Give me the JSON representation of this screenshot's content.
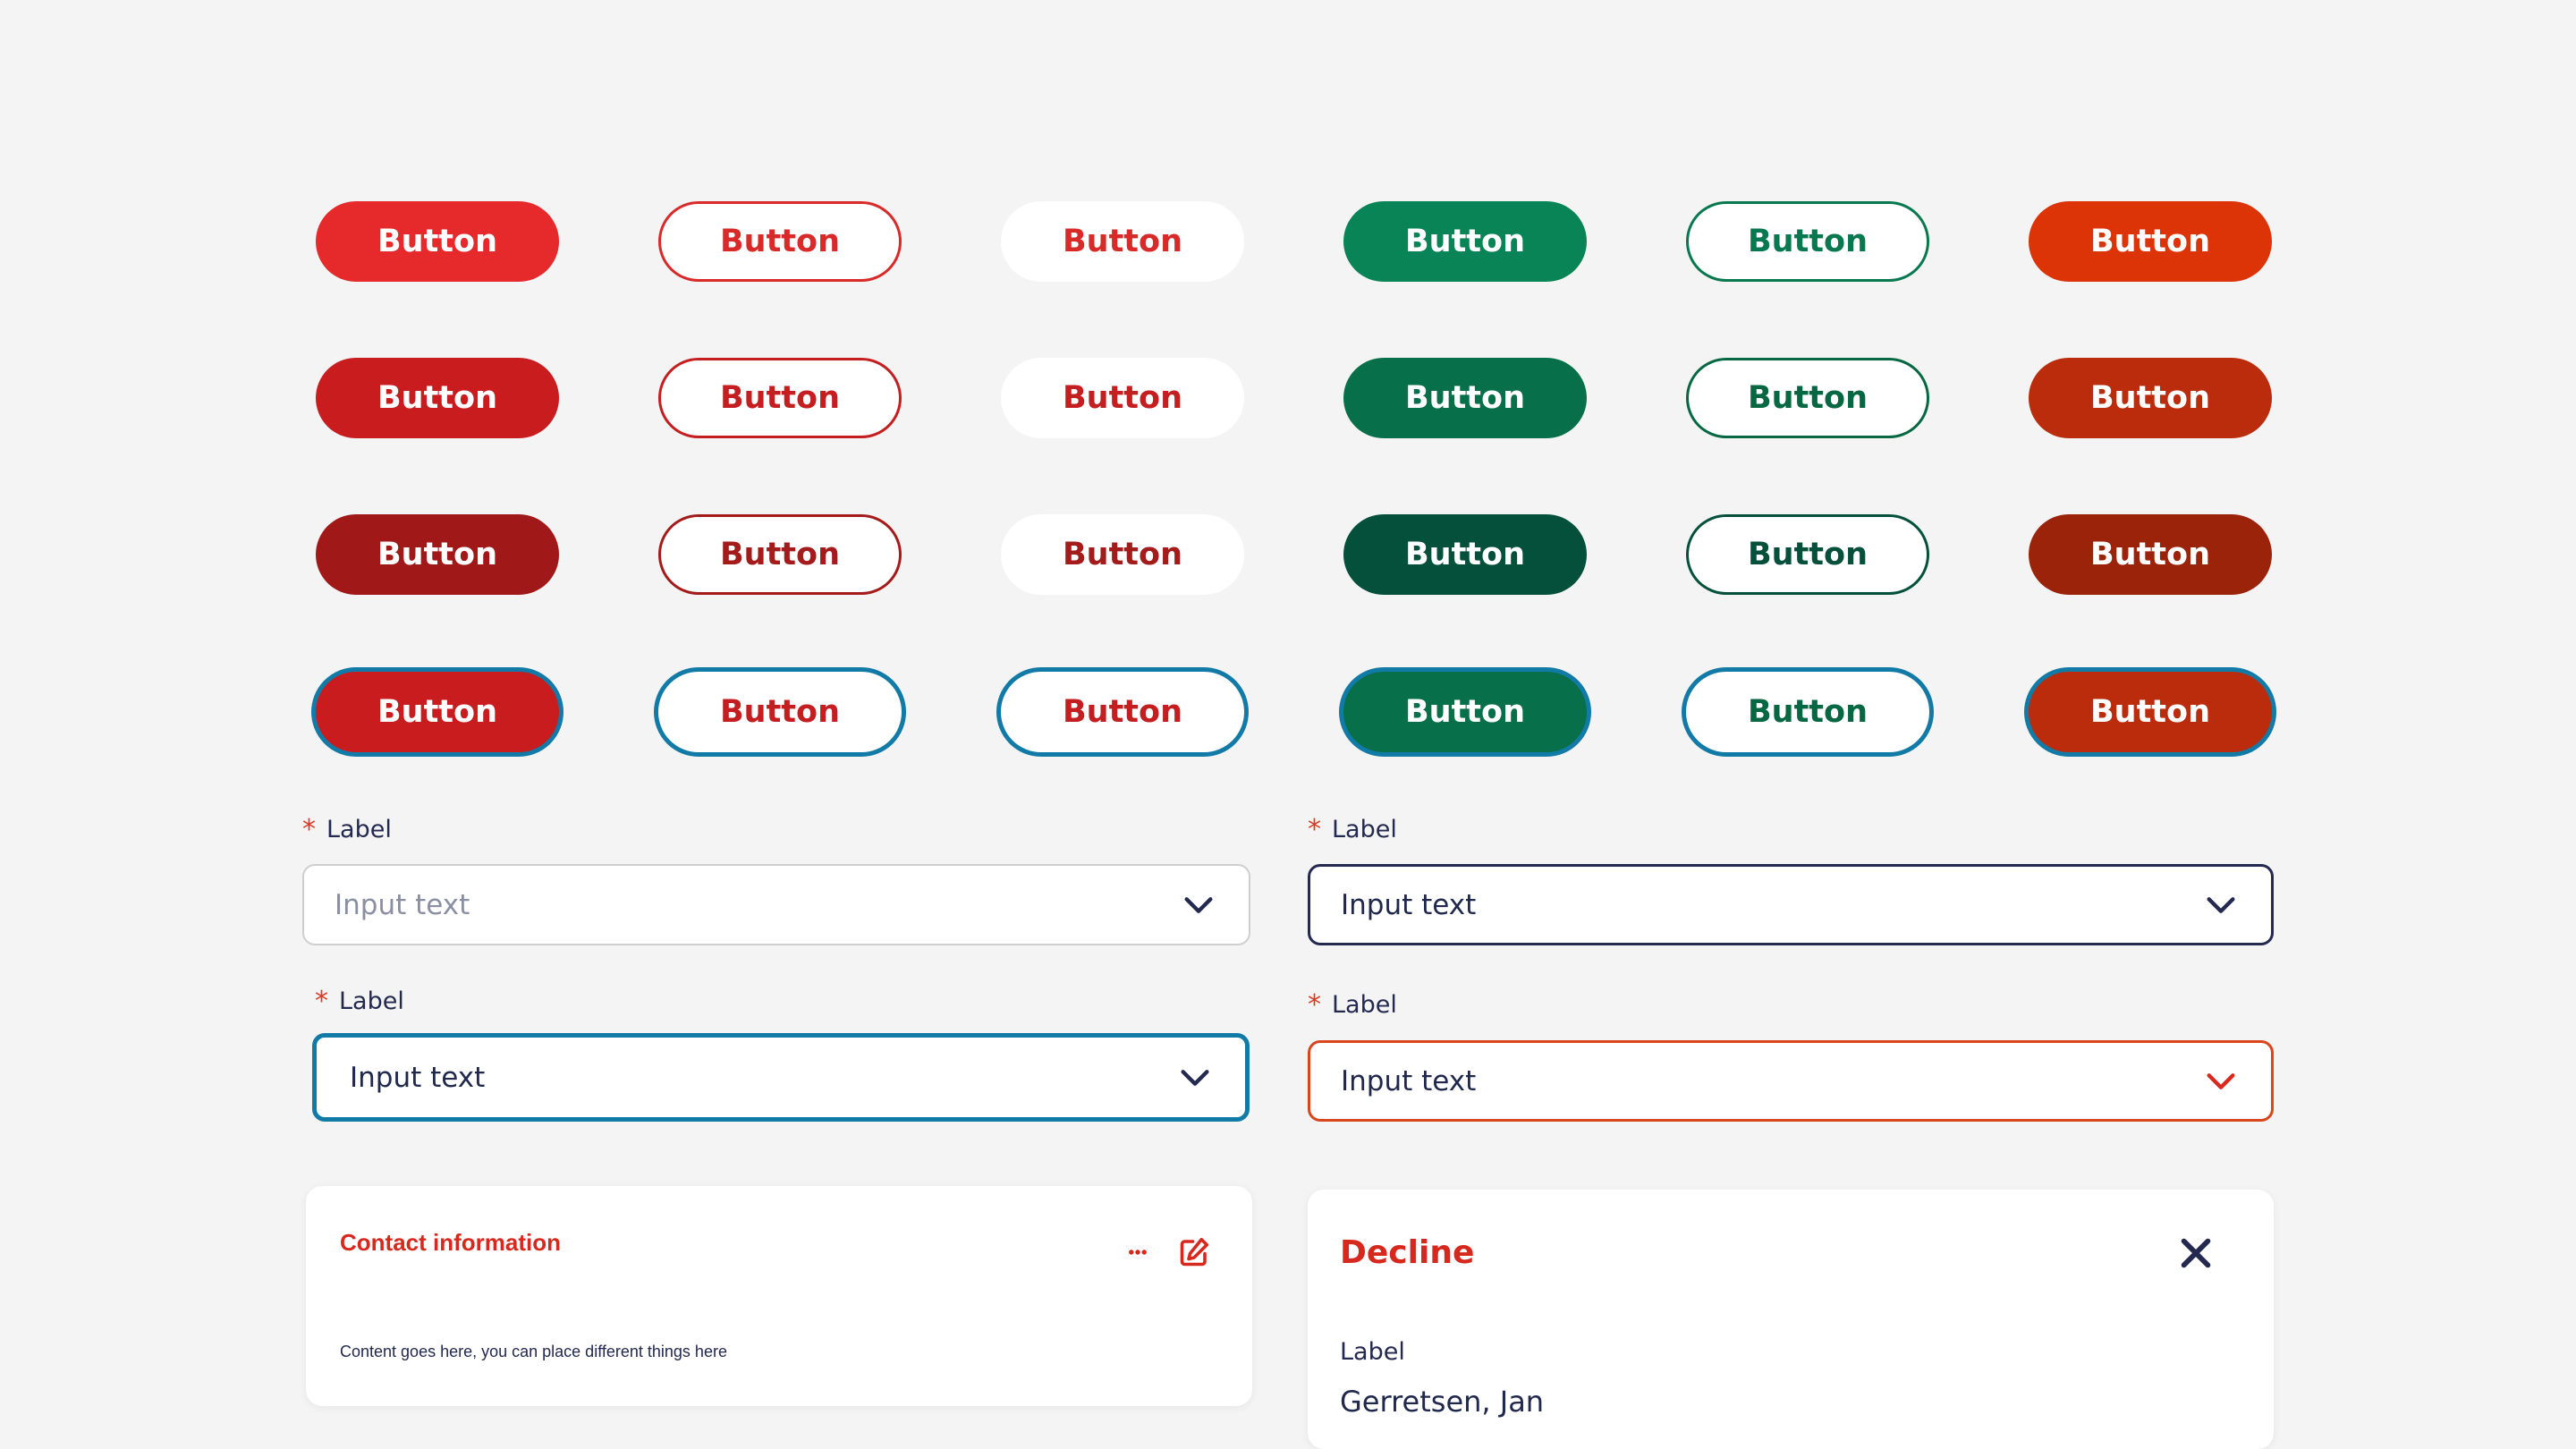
{
  "colors": {
    "red_1": "#e6292b",
    "red_2": "#c91c1f",
    "red_3": "#a11818",
    "green_1": "#088457",
    "green_2": "#07704a",
    "green_3": "#05503a",
    "orange_1": "#dc3307",
    "orange_2": "#bb2c0c",
    "orange_3": "#9a230a",
    "focus_ring": "#127aa7",
    "navy": "#23294f"
  },
  "buttons": {
    "row1": [
      "Button",
      "Button",
      "Button",
      "Button",
      "Button",
      "Button"
    ],
    "row2": [
      "Button",
      "Button",
      "Button",
      "Button",
      "Button",
      "Button"
    ],
    "row3": [
      "Button",
      "Button",
      "Button",
      "Button",
      "Button",
      "Button"
    ],
    "row4": [
      "Button",
      "Button",
      "Button",
      "Button",
      "Button",
      "Button"
    ]
  },
  "fields": [
    {
      "label": "Label",
      "required_mark": "*",
      "value": "Input text",
      "state": "placeholder"
    },
    {
      "label": "Label",
      "required_mark": "*",
      "value": "Input text",
      "state": "filled"
    },
    {
      "label": "Label",
      "required_mark": "*",
      "value": "Input text",
      "state": "focus"
    },
    {
      "label": "Label",
      "required_mark": "*",
      "value": "Input text",
      "state": "error"
    }
  ],
  "contact_card": {
    "title": "Contact information",
    "content": "Content goes here, you can place different things here",
    "icons": [
      "more-icon",
      "edit-icon"
    ]
  },
  "decline_panel": {
    "title": "Decline",
    "field_label": "Label",
    "field_value": "Gerretsen, Jan",
    "icons": [
      "close-icon"
    ]
  }
}
